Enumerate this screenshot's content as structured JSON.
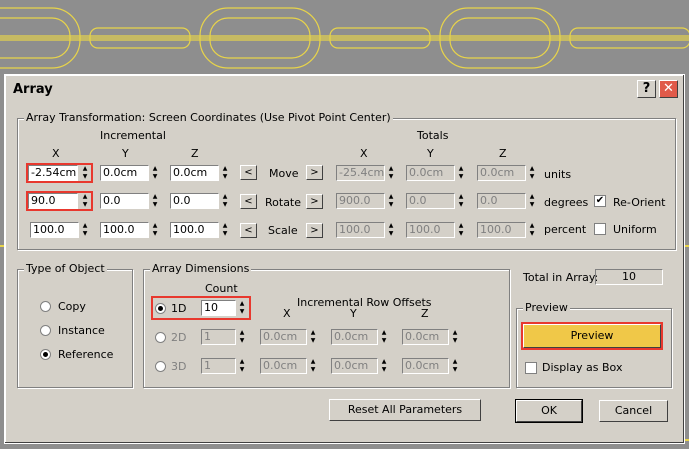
{
  "window": {
    "title": "Array",
    "help_label": "?",
    "close_label": "✕"
  },
  "transform": {
    "group_label": "Array Transformation: Screen Coordinates (Use Pivot Point Center)",
    "incremental_label": "Incremental",
    "totals_label": "Totals",
    "axis_x": "X",
    "axis_y": "Y",
    "axis_z": "Z",
    "move": {
      "label": "Move",
      "inc": [
        "-2.54cm",
        "0.0cm",
        "0.0cm"
      ],
      "tot": [
        "-25.4cm",
        "0.0cm",
        "0.0cm"
      ],
      "unit": "units"
    },
    "rotate": {
      "label": "Rotate",
      "inc": [
        "90.0",
        "0.0",
        "0.0"
      ],
      "tot": [
        "900.0",
        "0.0",
        "0.0"
      ],
      "unit": "degrees"
    },
    "scale": {
      "label": "Scale",
      "inc": [
        "100.0",
        "100.0",
        "100.0"
      ],
      "tot": [
        "100.0",
        "100.0",
        "100.0"
      ],
      "unit": "percent"
    },
    "left_arrow": "<",
    "right_arrow": ">",
    "reorient_label": "Re-Orient",
    "uniform_label": "Uniform"
  },
  "object_type": {
    "group_label": "Type of Object",
    "copy": "Copy",
    "instance": "Instance",
    "reference": "Reference",
    "selected": "Reference"
  },
  "dimensions": {
    "group_label": "Array Dimensions",
    "count_label": "Count",
    "offsets_label": "Incremental Row Offsets",
    "axis_x": "X",
    "axis_y": "Y",
    "axis_z": "Z",
    "d1": {
      "label": "1D",
      "count": "10"
    },
    "d2": {
      "label": "2D",
      "count": "1",
      "offsets": [
        "0.0cm",
        "0.0cm",
        "0.0cm"
      ]
    },
    "d3": {
      "label": "3D",
      "count": "1",
      "offsets": [
        "0.0cm",
        "0.0cm",
        "0.0cm"
      ]
    },
    "selected": "1D"
  },
  "total": {
    "label": "Total in Array:",
    "value": "10"
  },
  "preview": {
    "group_label": "Preview",
    "button_label": "Preview",
    "display_as_box": "Display as Box"
  },
  "buttons": {
    "reset": "Reset All Parameters",
    "ok": "OK",
    "cancel": "Cancel"
  },
  "colors": {
    "dialog_bg": "#d4d0c8",
    "highlight": "#e8382e",
    "preview_button": "#f0c848",
    "wire": "#e8d44a"
  }
}
